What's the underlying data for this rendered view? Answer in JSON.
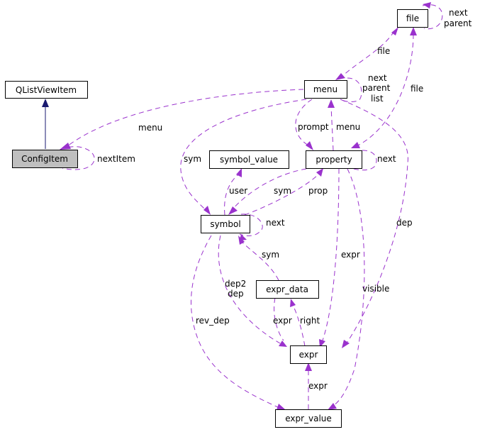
{
  "diagram": {
    "type": "collaboration-graph",
    "nodes": [
      {
        "id": "QListViewItem",
        "label": "QListViewItem"
      },
      {
        "id": "ConfigItem",
        "label": "ConfigItem",
        "highlighted": true
      },
      {
        "id": "file",
        "label": "file"
      },
      {
        "id": "menu",
        "label": "menu"
      },
      {
        "id": "symbol_value",
        "label": "symbol_value"
      },
      {
        "id": "property",
        "label": "property"
      },
      {
        "id": "symbol",
        "label": "symbol"
      },
      {
        "id": "expr_data",
        "label": "expr_data"
      },
      {
        "id": "expr",
        "label": "expr"
      },
      {
        "id": "expr_value",
        "label": "expr_value"
      }
    ],
    "edges": [
      {
        "from": "QListViewItem",
        "to": "ConfigItem",
        "kind": "inheritance",
        "label": ""
      },
      {
        "from": "ConfigItem",
        "to": "ConfigItem",
        "kind": "usage",
        "label": "nextItem"
      },
      {
        "from": "menu",
        "to": "ConfigItem",
        "kind": "usage",
        "label": "menu"
      },
      {
        "from": "file",
        "to": "file",
        "kind": "usage",
        "label": "next\nparent"
      },
      {
        "from": "file",
        "to": "menu",
        "kind": "usage",
        "label": "file"
      },
      {
        "from": "menu",
        "to": "menu",
        "kind": "usage",
        "label": "next\nparent\nlist"
      },
      {
        "from": "file",
        "to": "property",
        "kind": "usage",
        "label": "file"
      },
      {
        "from": "menu",
        "to": "property",
        "kind": "usage",
        "label": "prompt"
      },
      {
        "from": "property",
        "to": "menu",
        "kind": "usage",
        "label": "menu"
      },
      {
        "from": "property",
        "to": "property",
        "kind": "usage",
        "label": "next"
      },
      {
        "from": "menu",
        "to": "symbol",
        "kind": "usage",
        "label": "sym"
      },
      {
        "from": "symbol",
        "to": "symbol_value",
        "kind": "usage",
        "label": "user"
      },
      {
        "from": "property",
        "to": "symbol",
        "kind": "usage",
        "label": "sym"
      },
      {
        "from": "symbol",
        "to": "property",
        "kind": "usage",
        "label": "prop"
      },
      {
        "from": "symbol",
        "to": "symbol",
        "kind": "usage",
        "label": "next"
      },
      {
        "from": "menu",
        "to": "expr",
        "kind": "usage",
        "label": "dep"
      },
      {
        "from": "expr_data",
        "to": "symbol",
        "kind": "usage",
        "label": "sym"
      },
      {
        "from": "property",
        "to": "expr",
        "kind": "usage",
        "label": "expr"
      },
      {
        "from": "symbol",
        "to": "expr",
        "kind": "usage",
        "label": "dep2\ndep"
      },
      {
        "from": "expr",
        "to": "expr_data",
        "kind": "usage",
        "label": "right"
      },
      {
        "from": "expr_data",
        "to": "expr",
        "kind": "usage",
        "label": "expr"
      },
      {
        "from": "property",
        "to": "expr_value",
        "kind": "usage",
        "label": "visible"
      },
      {
        "from": "symbol",
        "to": "expr_value",
        "kind": "usage",
        "label": "rev_dep"
      },
      {
        "from": "expr_value",
        "to": "expr",
        "kind": "usage",
        "label": "expr"
      }
    ],
    "colors": {
      "usage_edge": "#9a32cd",
      "inheritance_edge": "#191970",
      "highlight_fill": "#bfbfbf"
    }
  }
}
